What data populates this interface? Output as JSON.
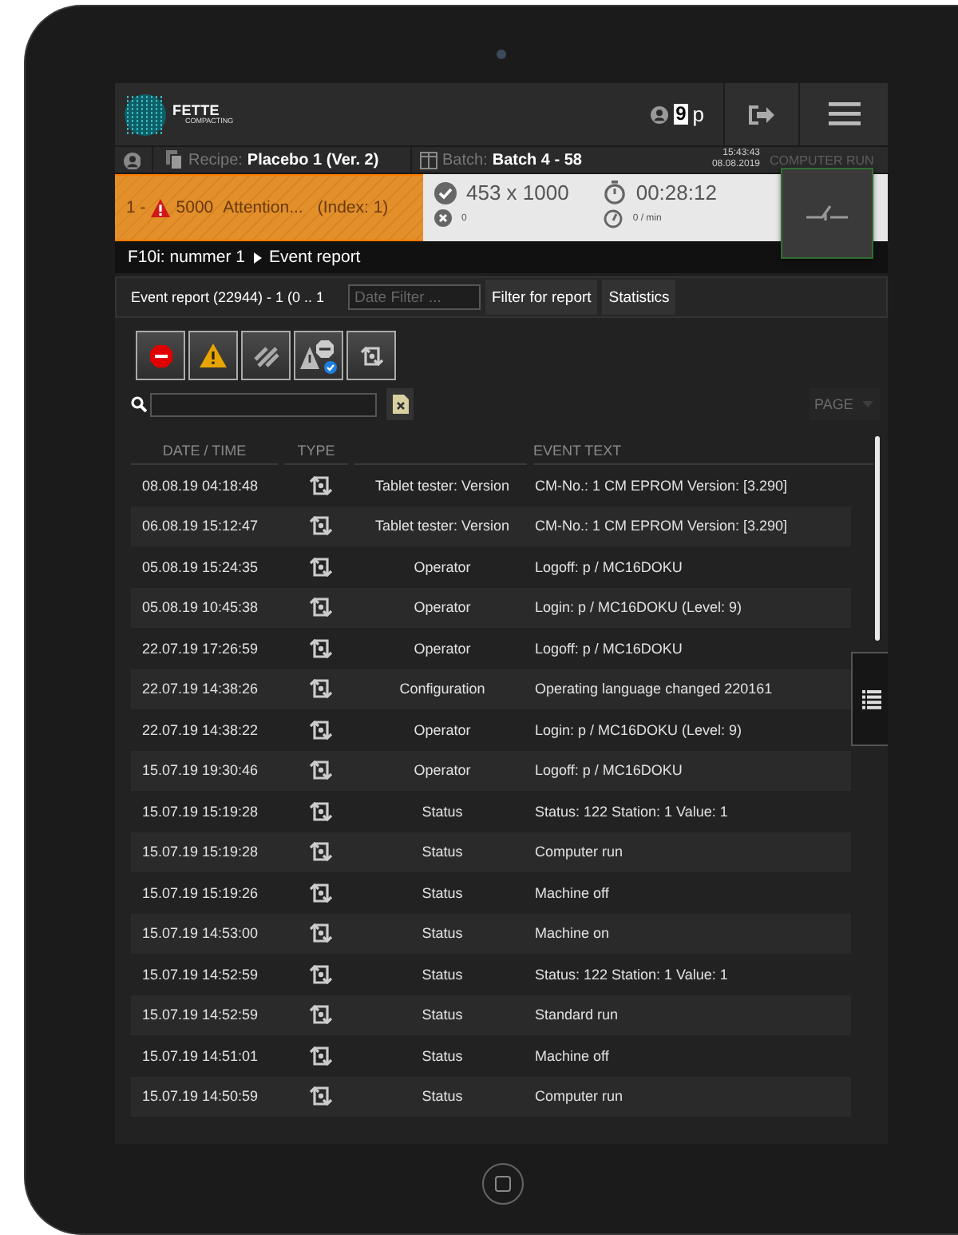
{
  "header": {
    "logo": {
      "name": "FETTE",
      "subtitle": "COMPACTING"
    },
    "user": {
      "level": "9",
      "name": "p"
    }
  },
  "info_bar": {
    "recipe_label": "Recipe:",
    "recipe": "Placebo 1 (Ver. 2)",
    "batch_label": "Batch:",
    "batch": "Batch 4 - 58",
    "time": "15:43:43",
    "date": "08.08.2019",
    "mode": "COMPUTER RUN"
  },
  "alarm": {
    "prefix": "1 -",
    "code": "5000",
    "message": "Attention...",
    "index": "(Index: 1)"
  },
  "counters": {
    "good": "453 x 1000",
    "rejected": "0",
    "runtime": "00:28:12",
    "rate": "0 / min"
  },
  "breadcrumb": [
    "F10i: nummer 1",
    "Event report"
  ],
  "toolbar": {
    "title": "Event report (22944) - 1 (0 .. 1",
    "date_filter": {
      "placeholder": "Date Filter ..."
    },
    "buttons": [
      "Filter for report",
      "Statistics"
    ]
  },
  "filter_buttons": [
    {
      "kind": "error"
    },
    {
      "kind": "warning"
    },
    {
      "kind": "hatched"
    },
    {
      "kind": "acknowledged"
    },
    {
      "kind": "event"
    }
  ],
  "page_select": "PAGE",
  "table": {
    "columns": {
      "date": "DATE / TIME",
      "type": "TYPE",
      "text": "EVENT TEXT"
    },
    "rows": [
      {
        "date": "08.08.19 04:18:48",
        "type": "Tablet tester: Version",
        "text": "CM-No.: 1 CM EPROM Version: [3.290]"
      },
      {
        "date": "06.08.19 15:12:47",
        "type": "Tablet tester: Version",
        "text": "CM-No.: 1 CM EPROM Version: [3.290]"
      },
      {
        "date": "05.08.19 15:24:35",
        "type": "Operator",
        "text": "Logoff: p / MC16DOKU"
      },
      {
        "date": "05.08.19 10:45:38",
        "type": "Operator",
        "text": "Login: p / MC16DOKU (Level: 9)"
      },
      {
        "date": "22.07.19 17:26:59",
        "type": "Operator",
        "text": "Logoff: p / MC16DOKU"
      },
      {
        "date": "22.07.19 14:38:26",
        "type": "Configuration",
        "text": "Operating language changed 220161"
      },
      {
        "date": "22.07.19 14:38:22",
        "type": "Operator",
        "text": "Login: p / MC16DOKU (Level: 9)"
      },
      {
        "date": "15.07.19 19:30:46",
        "type": "Operator",
        "text": "Logoff: p / MC16DOKU"
      },
      {
        "date": "15.07.19 15:19:28",
        "type": "Status",
        "text": "Status: 122 Station: 1 Value: 1"
      },
      {
        "date": "15.07.19 15:19:28",
        "type": "Status",
        "text": "Computer run"
      },
      {
        "date": "15.07.19 15:19:26",
        "type": "Status",
        "text": "Machine off"
      },
      {
        "date": "15.07.19 14:53:00",
        "type": "Status",
        "text": "Machine on"
      },
      {
        "date": "15.07.19 14:52:59",
        "type": "Status",
        "text": "Status: 122 Station: 1 Value: 1"
      },
      {
        "date": "15.07.19 14:52:59",
        "type": "Status",
        "text": "Standard run"
      },
      {
        "date": "15.07.19 14:51:01",
        "type": "Status",
        "text": "Machine off"
      },
      {
        "date": "15.07.19 14:50:59",
        "type": "Status",
        "text": "Computer run"
      }
    ]
  }
}
